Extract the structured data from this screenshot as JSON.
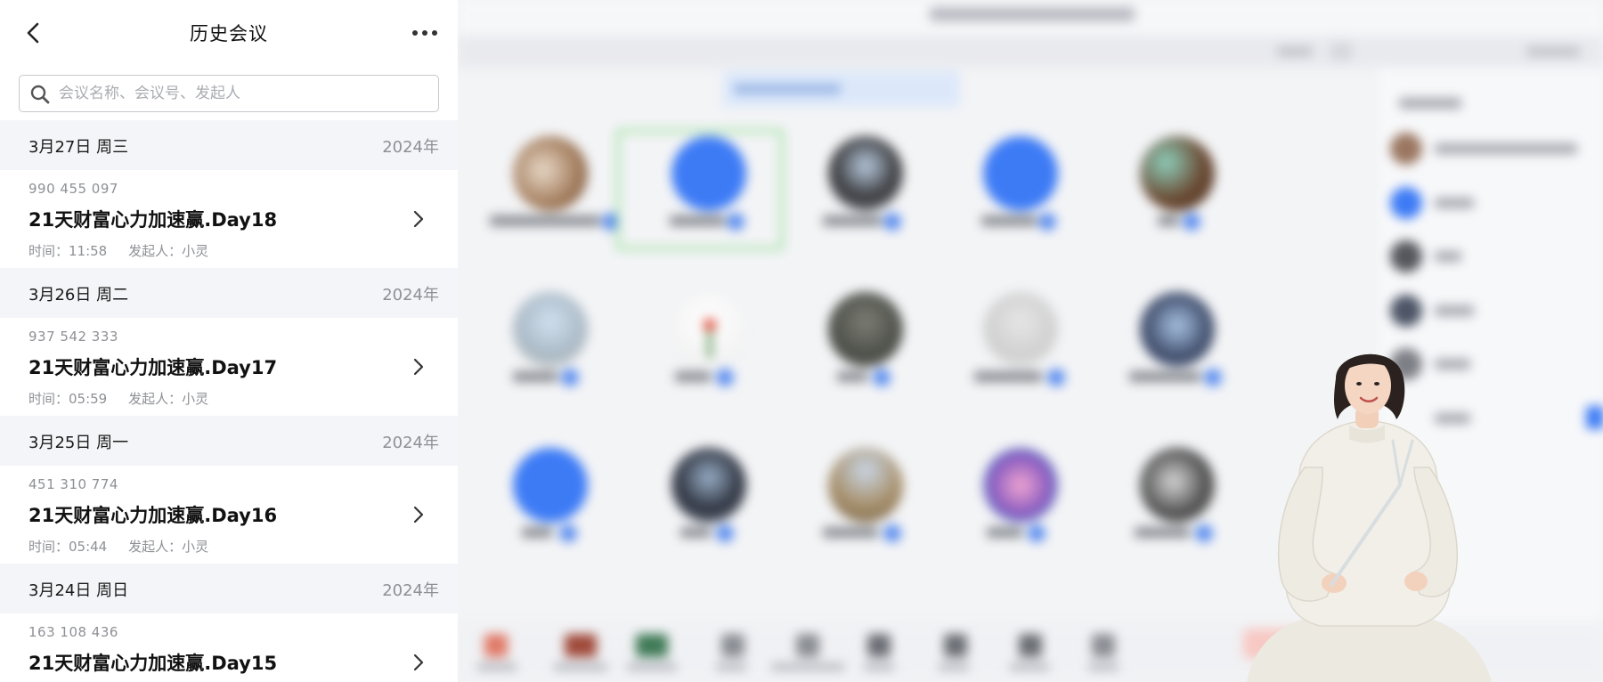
{
  "header": {
    "title": "历史会议"
  },
  "search": {
    "placeholder": "会议名称、会议号、发起人",
    "value": ""
  },
  "groups": [
    {
      "date": "3月27日 周三",
      "year": "2024年",
      "meeting": {
        "id": "990 455 097",
        "title": "21天财富心力加速赢.Day18",
        "time": "时间：11:58",
        "host": "发起人：小灵"
      }
    },
    {
      "date": "3月26日 周二",
      "year": "2024年",
      "meeting": {
        "id": "937 542 333",
        "title": "21天财富心力加速赢.Day17",
        "time": "时间：05:59",
        "host": "发起人：小灵"
      }
    },
    {
      "date": "3月25日 周一",
      "year": "2024年",
      "meeting": {
        "id": "451 310 774",
        "title": "21天财富心力加速赢.Day16",
        "time": "时间：05:44",
        "host": "发起人：小灵"
      }
    },
    {
      "date": "3月24日 周日",
      "year": "2024年",
      "meeting": {
        "id": "163 108 436",
        "title": "21天财富心力加速赢.Day15"
      }
    }
  ],
  "colors": {
    "section_bg": "#f4f5f8",
    "muted_text": "#8e9095",
    "accent_blue": "#3d7bf5",
    "active_tile_border": "#9ee29f"
  }
}
